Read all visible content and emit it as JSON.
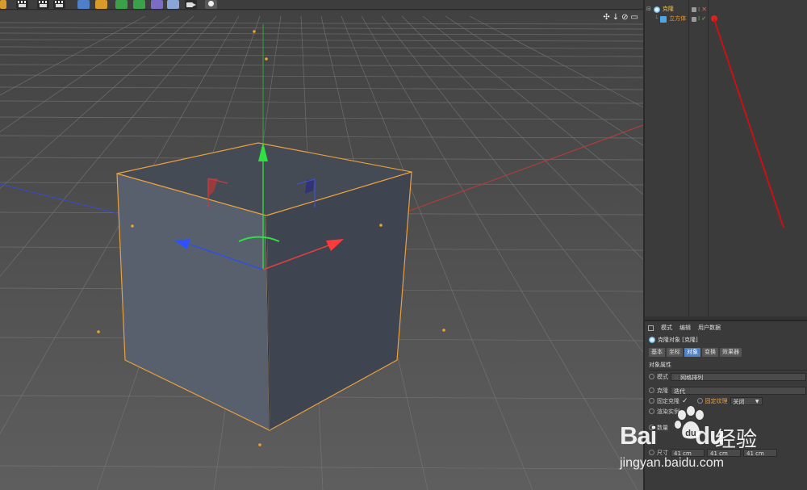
{
  "toolbar": {
    "buttons": [
      "play-clapper",
      "render-view",
      "render-settings",
      "cube",
      "spline-pen",
      "nurbs",
      "mograph",
      "deformer",
      "scene",
      "camera",
      "light"
    ]
  },
  "viewport": {
    "nav_icons": [
      "✣",
      "↓",
      "⊘",
      "▭"
    ]
  },
  "object_manager": {
    "objects": [
      {
        "name": "克隆",
        "type": "cloner"
      },
      {
        "name": "立方体",
        "type": "cube"
      }
    ]
  },
  "attribute_manager": {
    "menu": [
      "模式",
      "编辑",
      "用户数据"
    ],
    "title": "克隆对象 [克隆]",
    "tabs": [
      "基本",
      "坐标",
      "对象",
      "变换",
      "效果器"
    ],
    "active_tab": "对象",
    "section": "对象属性",
    "rows": {
      "mode_label": "模式",
      "mode_value": "网格排列",
      "clone_label": "克隆",
      "clone_value": "迭代",
      "fix_clone_label": "固定克隆",
      "fix_texture_label": "固定纹理",
      "fix_texture_value": "关闭",
      "render_instances_label": "渲染实例",
      "count_label": "数量",
      "size_label": "尺寸",
      "size_x": "41 cm",
      "size_y": "41 cm",
      "size_z": "41 cm"
    }
  },
  "watermark": {
    "brand_latin_1": "Bai",
    "brand_latin_2": "du",
    "brand_cn": "经验",
    "url": "jingyan.baidu.com"
  },
  "colors": {
    "axis_x": "#e04040",
    "axis_y": "#30d040",
    "axis_z": "#3050e0",
    "selection": "#e8a040",
    "annotation_line": "#cc1111"
  }
}
